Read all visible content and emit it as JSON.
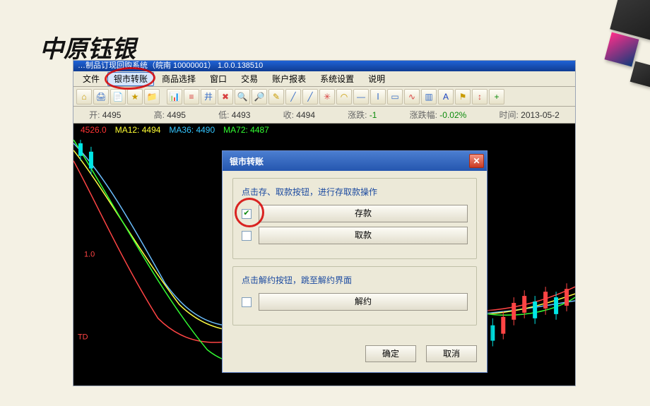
{
  "slide_title": "中原钰银",
  "app_titlebar": "…制品订现回购系统（皖南 10000001） 1.0.0.138510",
  "menu": [
    "文件",
    "银市转账",
    "商品选择",
    "窗口",
    "交易",
    "账户报表",
    "系统设置",
    "说明"
  ],
  "menu_highlight_index": 1,
  "toolbar_icons": [
    {
      "name": "home-icon",
      "glyph": "⌂",
      "color": "#c99b00"
    },
    {
      "name": "print-icon",
      "glyph": "🖨",
      "color": "#3a6fc9"
    },
    {
      "name": "doc-icon",
      "glyph": "📄",
      "color": "#c99b00"
    },
    {
      "name": "star-icon",
      "glyph": "★",
      "color": "#c99b00"
    },
    {
      "name": "folder-icon",
      "glyph": "📁",
      "color": "#c99b00"
    },
    {
      "name": "chart-icon",
      "glyph": "📊",
      "color": "#d84040"
    },
    {
      "name": "bars-icon",
      "glyph": "≡",
      "color": "#d84040"
    },
    {
      "name": "grid-icon",
      "glyph": "井",
      "color": "#3a6fc9"
    },
    {
      "name": "x-icon",
      "glyph": "✖",
      "color": "#d84040"
    },
    {
      "name": "zoom-in-icon",
      "glyph": "🔍",
      "color": "#3a6fc9"
    },
    {
      "name": "zoom-out-icon",
      "glyph": "🔎",
      "color": "#3a6fc9"
    },
    {
      "name": "pencil-icon",
      "glyph": "✎",
      "color": "#c99b00"
    },
    {
      "name": "line1-icon",
      "glyph": "╱",
      "color": "#3a6fc9"
    },
    {
      "name": "line2-icon",
      "glyph": "╱",
      "color": "#3a6fc9"
    },
    {
      "name": "fan-icon",
      "glyph": "✳",
      "color": "#d84040"
    },
    {
      "name": "arc-icon",
      "glyph": "◠",
      "color": "#c99b00"
    },
    {
      "name": "hline-icon",
      "glyph": "—",
      "color": "#3a6fc9"
    },
    {
      "name": "text-icon",
      "glyph": "Ⅰ",
      "color": "#3a6fc9"
    },
    {
      "name": "rect-icon",
      "glyph": "▭",
      "color": "#3a6fc9"
    },
    {
      "name": "wave-icon",
      "glyph": "∿",
      "color": "#d84040"
    },
    {
      "name": "box-icon",
      "glyph": "▥",
      "color": "#3a6fc9"
    },
    {
      "name": "a-icon",
      "glyph": "A",
      "color": "#1740c0"
    },
    {
      "name": "tag-icon",
      "glyph": "⚑",
      "color": "#c99b00"
    },
    {
      "name": "ruler-icon",
      "glyph": "↕",
      "color": "#d84040"
    },
    {
      "name": "plus-icon",
      "glyph": "+",
      "color": "#0a8a0a"
    }
  ],
  "price_bar": {
    "open_lbl": "开:",
    "open": "4495",
    "high_lbl": "高:",
    "high": "4495",
    "low_lbl": "低:",
    "low": "4493",
    "close_lbl": "收:",
    "close": "4494",
    "change_lbl": "涨跌:",
    "change": "-1",
    "change_pct_lbl": "涨跌幅:",
    "change_pct": "-0.02%",
    "time_lbl": "时间:",
    "time": "2013-05-2"
  },
  "ma": {
    "ma5_lbl": "4526.0",
    "ma12_lbl": "MA12: 4494",
    "ma36_lbl": "MA36: 4490",
    "ma72_lbl": "MA72: 4487"
  },
  "chart_labels": {
    "axis": "1.0",
    "td": "TD"
  },
  "dialog": {
    "title": "银市转账",
    "group1_title": "点击存、取款按钮，进行存取款操作",
    "deposit": "存款",
    "withdraw": "取款",
    "deposit_checked": true,
    "withdraw_checked": false,
    "group2_title": "点击解约按钮，跳至解约界面",
    "cancel_contract": "解约",
    "cancel_contract_checked": false,
    "ok": "确定",
    "cancel": "取消"
  }
}
